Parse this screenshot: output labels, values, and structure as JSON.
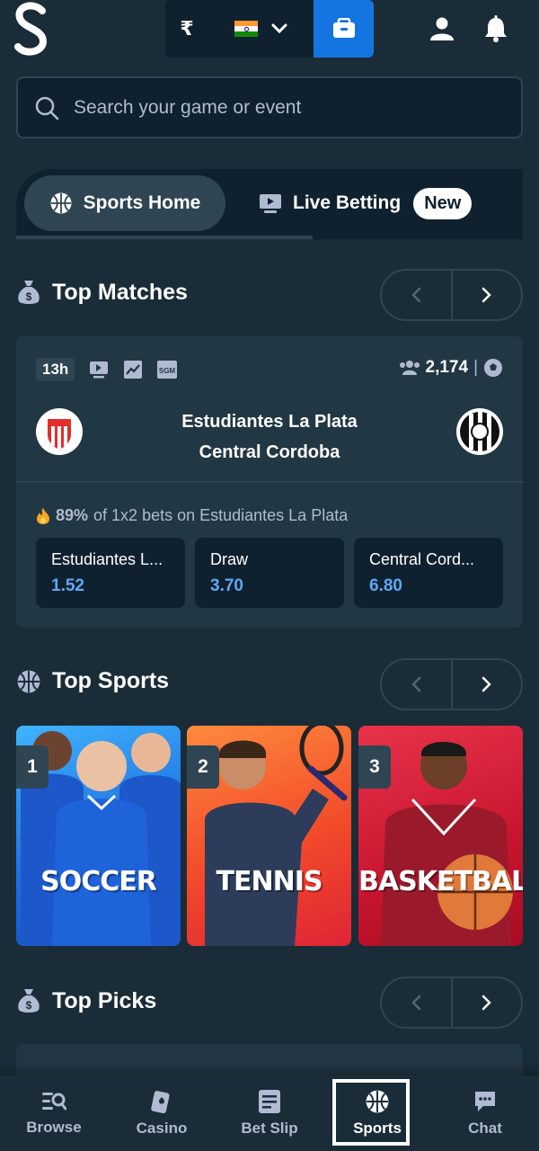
{
  "header": {
    "currency_symbol": "₹",
    "icons": [
      "stake-logo-icon",
      "india-flag-icon",
      "chevron-down-icon",
      "wallet-icon",
      "user-icon",
      "bell-icon"
    ]
  },
  "search": {
    "placeholder": "Search your game or event"
  },
  "tabs": {
    "sports_home": "Sports Home",
    "live_betting": "Live Betting",
    "new_badge": "New"
  },
  "top_matches": {
    "title": "Top Matches",
    "match": {
      "time": "13h",
      "watchers": "2,174",
      "team_home": "Estudiantes La Plata",
      "team_away": "Central Cordoba",
      "stat_percent": "89%",
      "stat_text": "of 1x2 bets on Estudiantes La Plata",
      "odds": [
        {
          "name": "Estudiantes L...",
          "price": "1.52"
        },
        {
          "name": "Draw",
          "price": "3.70"
        },
        {
          "name": "Central Cord...",
          "price": "6.80"
        }
      ]
    }
  },
  "top_sports": {
    "title": "Top Sports",
    "tiles": [
      {
        "rank": "1",
        "label": "SOCCER"
      },
      {
        "rank": "2",
        "label": "TENNIS"
      },
      {
        "rank": "3",
        "label": "BASKETBALL"
      }
    ]
  },
  "top_picks": {
    "title": "Top Picks"
  },
  "bottom_nav": {
    "items": [
      {
        "label": "Browse"
      },
      {
        "label": "Casino"
      },
      {
        "label": "Bet Slip"
      },
      {
        "label": "Sports"
      },
      {
        "label": "Chat"
      }
    ]
  },
  "colors": {
    "bg": "#1a2c38",
    "panel": "#213743",
    "dark": "#0f212e",
    "accent": "#1475e1",
    "odds": "#5fa8f5"
  }
}
